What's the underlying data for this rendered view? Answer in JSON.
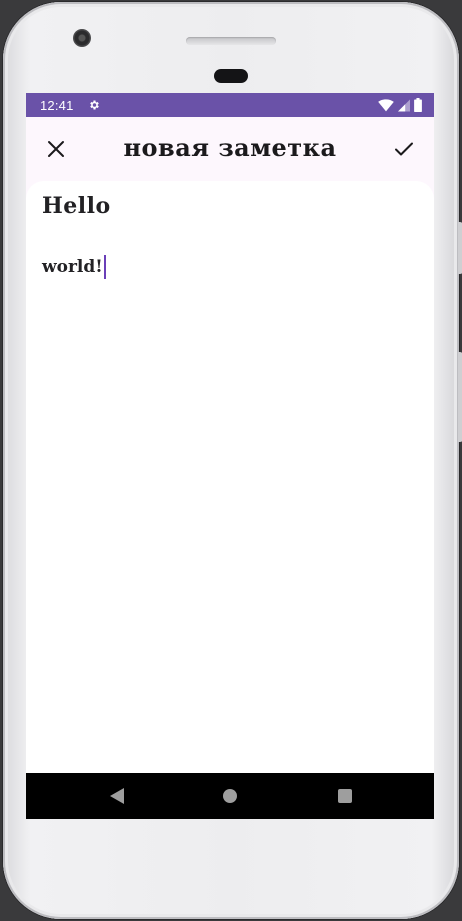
{
  "status_bar": {
    "time": "12:41",
    "icons": [
      "settings-gear-icon",
      "wifi-icon",
      "cellular-signal-icon",
      "battery-icon"
    ]
  },
  "app_bar": {
    "title": "новая заметка",
    "close_icon": "close-icon",
    "confirm_icon": "check-icon"
  },
  "note": {
    "title_value": "Hello",
    "body_value": "world!"
  },
  "nav_bar": {
    "icons": [
      "back-icon",
      "home-icon",
      "recents-icon"
    ]
  },
  "colors": {
    "status_bar": "#6a52a8",
    "app_bar_bg": "#fdf7fd",
    "cursor": "#6a3fb8",
    "text": "#222124",
    "nav_bar": "#000000"
  }
}
